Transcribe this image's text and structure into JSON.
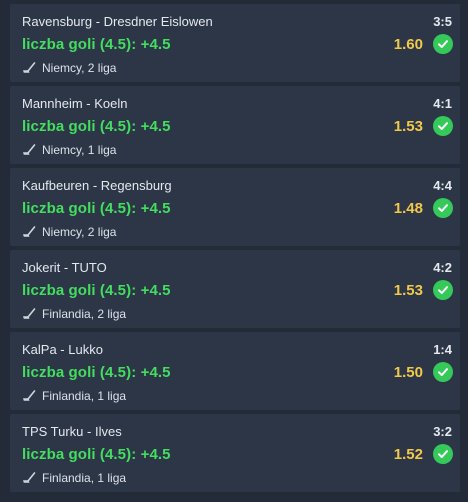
{
  "bets": [
    {
      "teams": "Ravensburg - Dresdner Eislowen",
      "score": "3:5",
      "market": "liczba goli (4.5): +4.5",
      "odds": "1.60",
      "league": "Niemcy, 2 liga",
      "status": "won"
    },
    {
      "teams": "Mannheim - Koeln",
      "score": "4:1",
      "market": "liczba goli (4.5): +4.5",
      "odds": "1.53",
      "league": "Niemcy, 1 liga",
      "status": "won"
    },
    {
      "teams": "Kaufbeuren - Regensburg",
      "score": "4:4",
      "market": "liczba goli (4.5): +4.5",
      "odds": "1.48",
      "league": "Niemcy, 2 liga",
      "status": "won"
    },
    {
      "teams": "Jokerit - TUTO",
      "score": "4:2",
      "market": "liczba goli (4.5): +4.5",
      "odds": "1.53",
      "league": "Finlandia, 2 liga",
      "status": "won"
    },
    {
      "teams": "KalPa - Lukko",
      "score": "1:4",
      "market": "liczba goli (4.5): +4.5",
      "odds": "1.50",
      "league": "Finlandia, 1 liga",
      "status": "won"
    },
    {
      "teams": "TPS Turku - Ilves",
      "score": "3:2",
      "market": "liczba goli (4.5): +4.5",
      "odds": "1.52",
      "league": "Finlandia, 1 liga",
      "status": "won"
    }
  ],
  "icons": {
    "sport": "hockey-stick-icon",
    "status": "check-circle-icon"
  },
  "colors": {
    "background": "#232b38",
    "card": "#2c3646",
    "market": "#43dd5f",
    "odds": "#f2c84b",
    "check": "#35c95a"
  }
}
